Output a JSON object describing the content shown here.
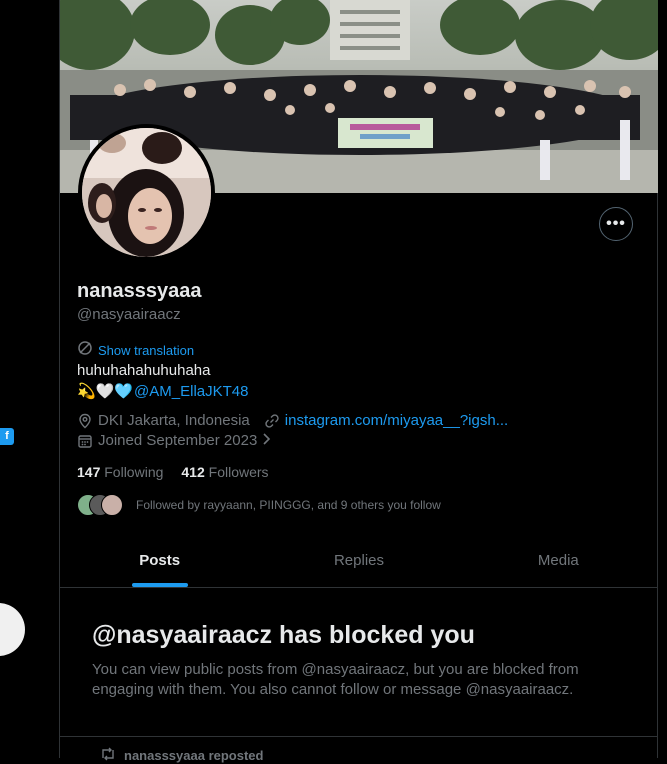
{
  "profile": {
    "display_name": "nanasssyaaa",
    "handle": "@nasyaairaacz",
    "show_translation": "Show translation",
    "bio_line1": "huhuhahahuhuhaha",
    "bio_emojis": "💫🤍🩵",
    "bio_mention": "@AM_EllaJKT48",
    "location": "DKI Jakarta, Indonesia",
    "website": "instagram.com/miyayaa__?igsh...",
    "joined": "Joined September 2023",
    "following_count": "147",
    "following_label": "Following",
    "followers_count": "412",
    "followers_label": "Followers",
    "followed_by": "Followed by rayyaann, PIINGGG, and 9 others you follow"
  },
  "tabs": [
    {
      "label": "Posts",
      "active": true
    },
    {
      "label": "Replies",
      "active": false
    },
    {
      "label": "Media",
      "active": false
    }
  ],
  "blocked": {
    "title": "@nasyaairaacz has blocked you",
    "message": "You can view public posts from @nasyaairaacz, but you are blocked from engaging with them. You also cannot follow or message @nasyaairaacz."
  },
  "repost": {
    "label": "nanasssyaaa reposted"
  },
  "left_rail": {
    "badge": "f"
  },
  "colors": {
    "accent": "#1d9bf0",
    "background": "#000000",
    "muted": "#71767b",
    "border": "#2f3336"
  }
}
